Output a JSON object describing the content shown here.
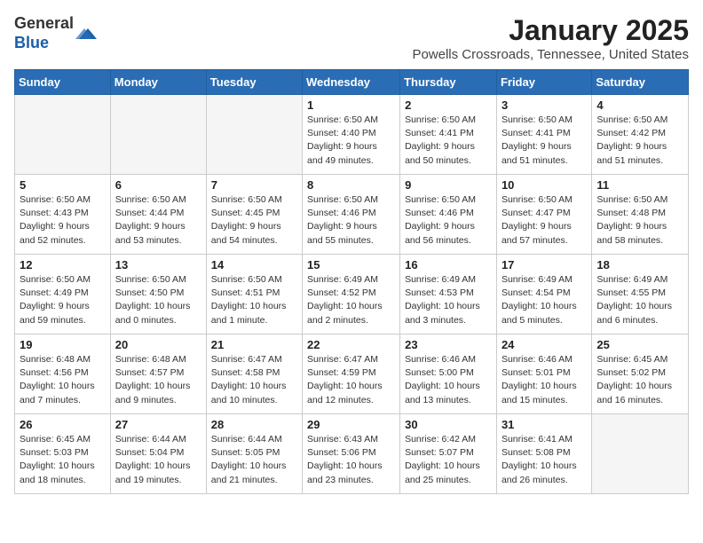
{
  "logo": {
    "general": "General",
    "blue": "Blue"
  },
  "title": "January 2025",
  "location": "Powells Crossroads, Tennessee, United States",
  "days_of_week": [
    "Sunday",
    "Monday",
    "Tuesday",
    "Wednesday",
    "Thursday",
    "Friday",
    "Saturday"
  ],
  "weeks": [
    [
      {
        "day": "",
        "info": ""
      },
      {
        "day": "",
        "info": ""
      },
      {
        "day": "",
        "info": ""
      },
      {
        "day": "1",
        "info": "Sunrise: 6:50 AM\nSunset: 4:40 PM\nDaylight: 9 hours and 49 minutes."
      },
      {
        "day": "2",
        "info": "Sunrise: 6:50 AM\nSunset: 4:41 PM\nDaylight: 9 hours and 50 minutes."
      },
      {
        "day": "3",
        "info": "Sunrise: 6:50 AM\nSunset: 4:41 PM\nDaylight: 9 hours and 51 minutes."
      },
      {
        "day": "4",
        "info": "Sunrise: 6:50 AM\nSunset: 4:42 PM\nDaylight: 9 hours and 51 minutes."
      }
    ],
    [
      {
        "day": "5",
        "info": "Sunrise: 6:50 AM\nSunset: 4:43 PM\nDaylight: 9 hours and 52 minutes."
      },
      {
        "day": "6",
        "info": "Sunrise: 6:50 AM\nSunset: 4:44 PM\nDaylight: 9 hours and 53 minutes."
      },
      {
        "day": "7",
        "info": "Sunrise: 6:50 AM\nSunset: 4:45 PM\nDaylight: 9 hours and 54 minutes."
      },
      {
        "day": "8",
        "info": "Sunrise: 6:50 AM\nSunset: 4:46 PM\nDaylight: 9 hours and 55 minutes."
      },
      {
        "day": "9",
        "info": "Sunrise: 6:50 AM\nSunset: 4:46 PM\nDaylight: 9 hours and 56 minutes."
      },
      {
        "day": "10",
        "info": "Sunrise: 6:50 AM\nSunset: 4:47 PM\nDaylight: 9 hours and 57 minutes."
      },
      {
        "day": "11",
        "info": "Sunrise: 6:50 AM\nSunset: 4:48 PM\nDaylight: 9 hours and 58 minutes."
      }
    ],
    [
      {
        "day": "12",
        "info": "Sunrise: 6:50 AM\nSunset: 4:49 PM\nDaylight: 9 hours and 59 minutes."
      },
      {
        "day": "13",
        "info": "Sunrise: 6:50 AM\nSunset: 4:50 PM\nDaylight: 10 hours and 0 minutes."
      },
      {
        "day": "14",
        "info": "Sunrise: 6:50 AM\nSunset: 4:51 PM\nDaylight: 10 hours and 1 minute."
      },
      {
        "day": "15",
        "info": "Sunrise: 6:49 AM\nSunset: 4:52 PM\nDaylight: 10 hours and 2 minutes."
      },
      {
        "day": "16",
        "info": "Sunrise: 6:49 AM\nSunset: 4:53 PM\nDaylight: 10 hours and 3 minutes."
      },
      {
        "day": "17",
        "info": "Sunrise: 6:49 AM\nSunset: 4:54 PM\nDaylight: 10 hours and 5 minutes."
      },
      {
        "day": "18",
        "info": "Sunrise: 6:49 AM\nSunset: 4:55 PM\nDaylight: 10 hours and 6 minutes."
      }
    ],
    [
      {
        "day": "19",
        "info": "Sunrise: 6:48 AM\nSunset: 4:56 PM\nDaylight: 10 hours and 7 minutes."
      },
      {
        "day": "20",
        "info": "Sunrise: 6:48 AM\nSunset: 4:57 PM\nDaylight: 10 hours and 9 minutes."
      },
      {
        "day": "21",
        "info": "Sunrise: 6:47 AM\nSunset: 4:58 PM\nDaylight: 10 hours and 10 minutes."
      },
      {
        "day": "22",
        "info": "Sunrise: 6:47 AM\nSunset: 4:59 PM\nDaylight: 10 hours and 12 minutes."
      },
      {
        "day": "23",
        "info": "Sunrise: 6:46 AM\nSunset: 5:00 PM\nDaylight: 10 hours and 13 minutes."
      },
      {
        "day": "24",
        "info": "Sunrise: 6:46 AM\nSunset: 5:01 PM\nDaylight: 10 hours and 15 minutes."
      },
      {
        "day": "25",
        "info": "Sunrise: 6:45 AM\nSunset: 5:02 PM\nDaylight: 10 hours and 16 minutes."
      }
    ],
    [
      {
        "day": "26",
        "info": "Sunrise: 6:45 AM\nSunset: 5:03 PM\nDaylight: 10 hours and 18 minutes."
      },
      {
        "day": "27",
        "info": "Sunrise: 6:44 AM\nSunset: 5:04 PM\nDaylight: 10 hours and 19 minutes."
      },
      {
        "day": "28",
        "info": "Sunrise: 6:44 AM\nSunset: 5:05 PM\nDaylight: 10 hours and 21 minutes."
      },
      {
        "day": "29",
        "info": "Sunrise: 6:43 AM\nSunset: 5:06 PM\nDaylight: 10 hours and 23 minutes."
      },
      {
        "day": "30",
        "info": "Sunrise: 6:42 AM\nSunset: 5:07 PM\nDaylight: 10 hours and 25 minutes."
      },
      {
        "day": "31",
        "info": "Sunrise: 6:41 AM\nSunset: 5:08 PM\nDaylight: 10 hours and 26 minutes."
      },
      {
        "day": "",
        "info": ""
      }
    ]
  ]
}
